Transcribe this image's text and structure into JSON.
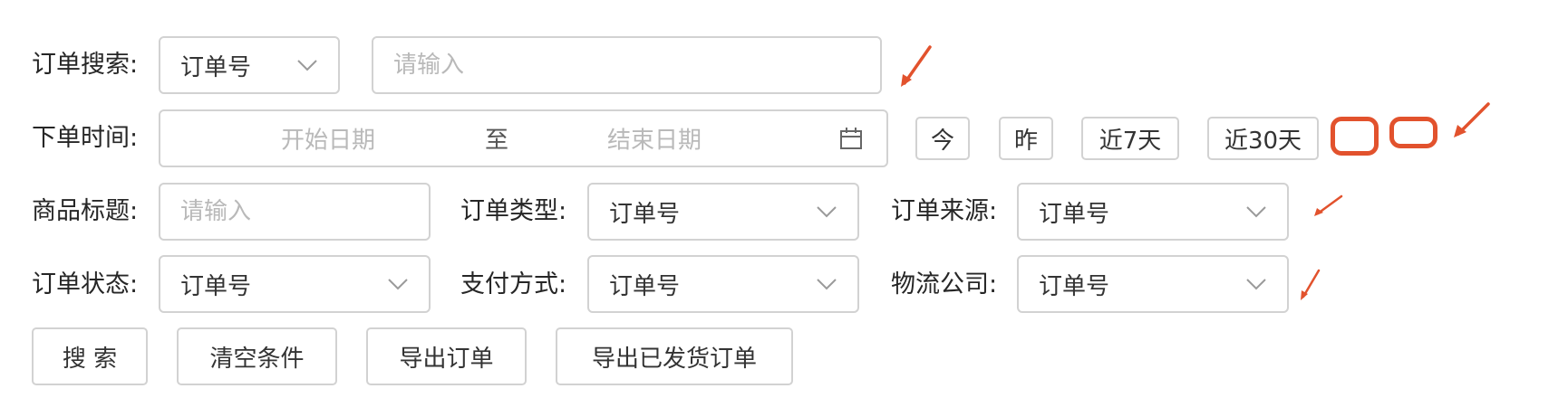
{
  "labels": {
    "order_search": "订单搜索:",
    "order_time": "下单时间:",
    "product_title": "商品标题:",
    "order_type": "订单类型:",
    "order_source": "订单来源:",
    "order_status": "订单状态:",
    "payment_method": "支付方式:",
    "logistics_company": "物流公司:"
  },
  "fields": {
    "search_type_value": "订单号",
    "search_placeholder": "请输入",
    "start_date_placeholder": "开始日期",
    "date_separator": "至",
    "end_date_placeholder": "结束日期",
    "product_title_placeholder": "请输入",
    "order_type_value": "订单号",
    "order_source_value": "订单号",
    "order_status_value": "订单号",
    "payment_method_value": "订单号",
    "logistics_company_value": "订单号"
  },
  "quick_dates": {
    "today": "今",
    "yesterday": "昨",
    "last7": "近7天",
    "last30": "近30天"
  },
  "actions": {
    "search": "搜 索",
    "clear": "清空条件",
    "export": "导出订单",
    "export_shipped": "导出已发货订单"
  },
  "icons": {
    "dropdown": "chevron-down-icon",
    "calendar": "calendar-icon"
  },
  "colors": {
    "annotation": "#e2522d",
    "border": "#d2d2d2",
    "placeholder": "#b9b9b9"
  }
}
